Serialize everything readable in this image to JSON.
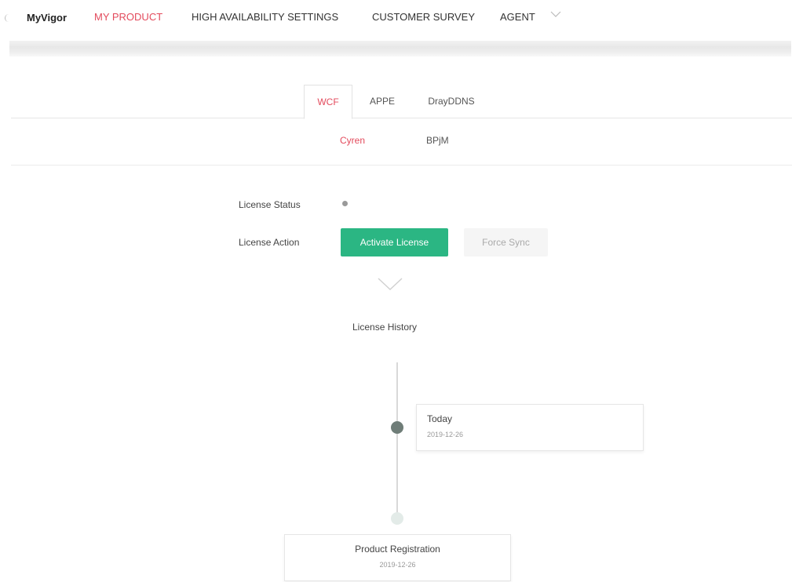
{
  "nav": {
    "brand": "MyVigor",
    "items": [
      "MY PRODUCT",
      "HIGH AVAILABILITY SETTINGS",
      "CUSTOMER SURVEY",
      "AGENT"
    ],
    "active_item": "MY PRODUCT",
    "agent_dropdown_icon": "chevron-down-icon"
  },
  "tabs": [
    "WCF",
    "APPE",
    "DrayDDNS"
  ],
  "active_tab": "WCF",
  "subtabs": [
    "Cyren",
    "BPjM"
  ],
  "active_subtab": "Cyren",
  "license": {
    "status_label": "License Status",
    "action_label": "License Action",
    "activate_button": "Activate License",
    "force_sync_button": "Force Sync",
    "expand_icon": "chevron-down-icon"
  },
  "history": {
    "title": "License History",
    "entries": [
      {
        "title": "Today",
        "date": "2019-12-26"
      },
      {
        "title": "Product Registration",
        "date": "2019-12-26"
      }
    ]
  },
  "colors": {
    "accent": "#e34a5c",
    "primary_button": "#2bb683",
    "status_dot": "#9a9a9a",
    "timeline_dot_active": "#6f7d78",
    "timeline_dot_inactive": "#e3ebe8"
  }
}
